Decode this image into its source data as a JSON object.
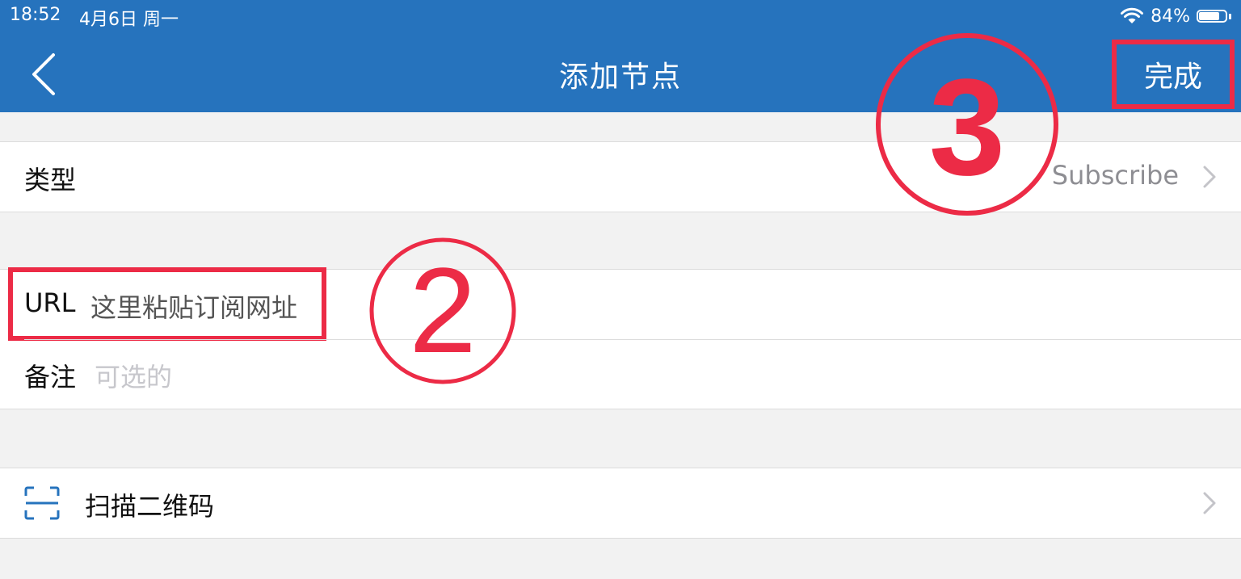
{
  "status_bar": {
    "time": "18:52",
    "date": "4月6日 周一",
    "battery": "84%",
    "battery_level": 0.84
  },
  "nav": {
    "title": "添加节点",
    "done_label": "完成"
  },
  "form": {
    "type": {
      "label": "类型",
      "value": "Subscribe"
    },
    "url": {
      "label": "URL",
      "value": "这里粘贴订阅网址"
    },
    "note": {
      "label": "备注",
      "placeholder": "可选的"
    },
    "scan": {
      "label": "扫描二维码"
    }
  },
  "annotations": {
    "step2": "2",
    "step3": "3",
    "color": "#ec2b46"
  },
  "colors": {
    "header": "#2673bd",
    "background": "#f2f2f2",
    "secondary_text": "#8e8e93",
    "placeholder": "#c7c7cc"
  }
}
